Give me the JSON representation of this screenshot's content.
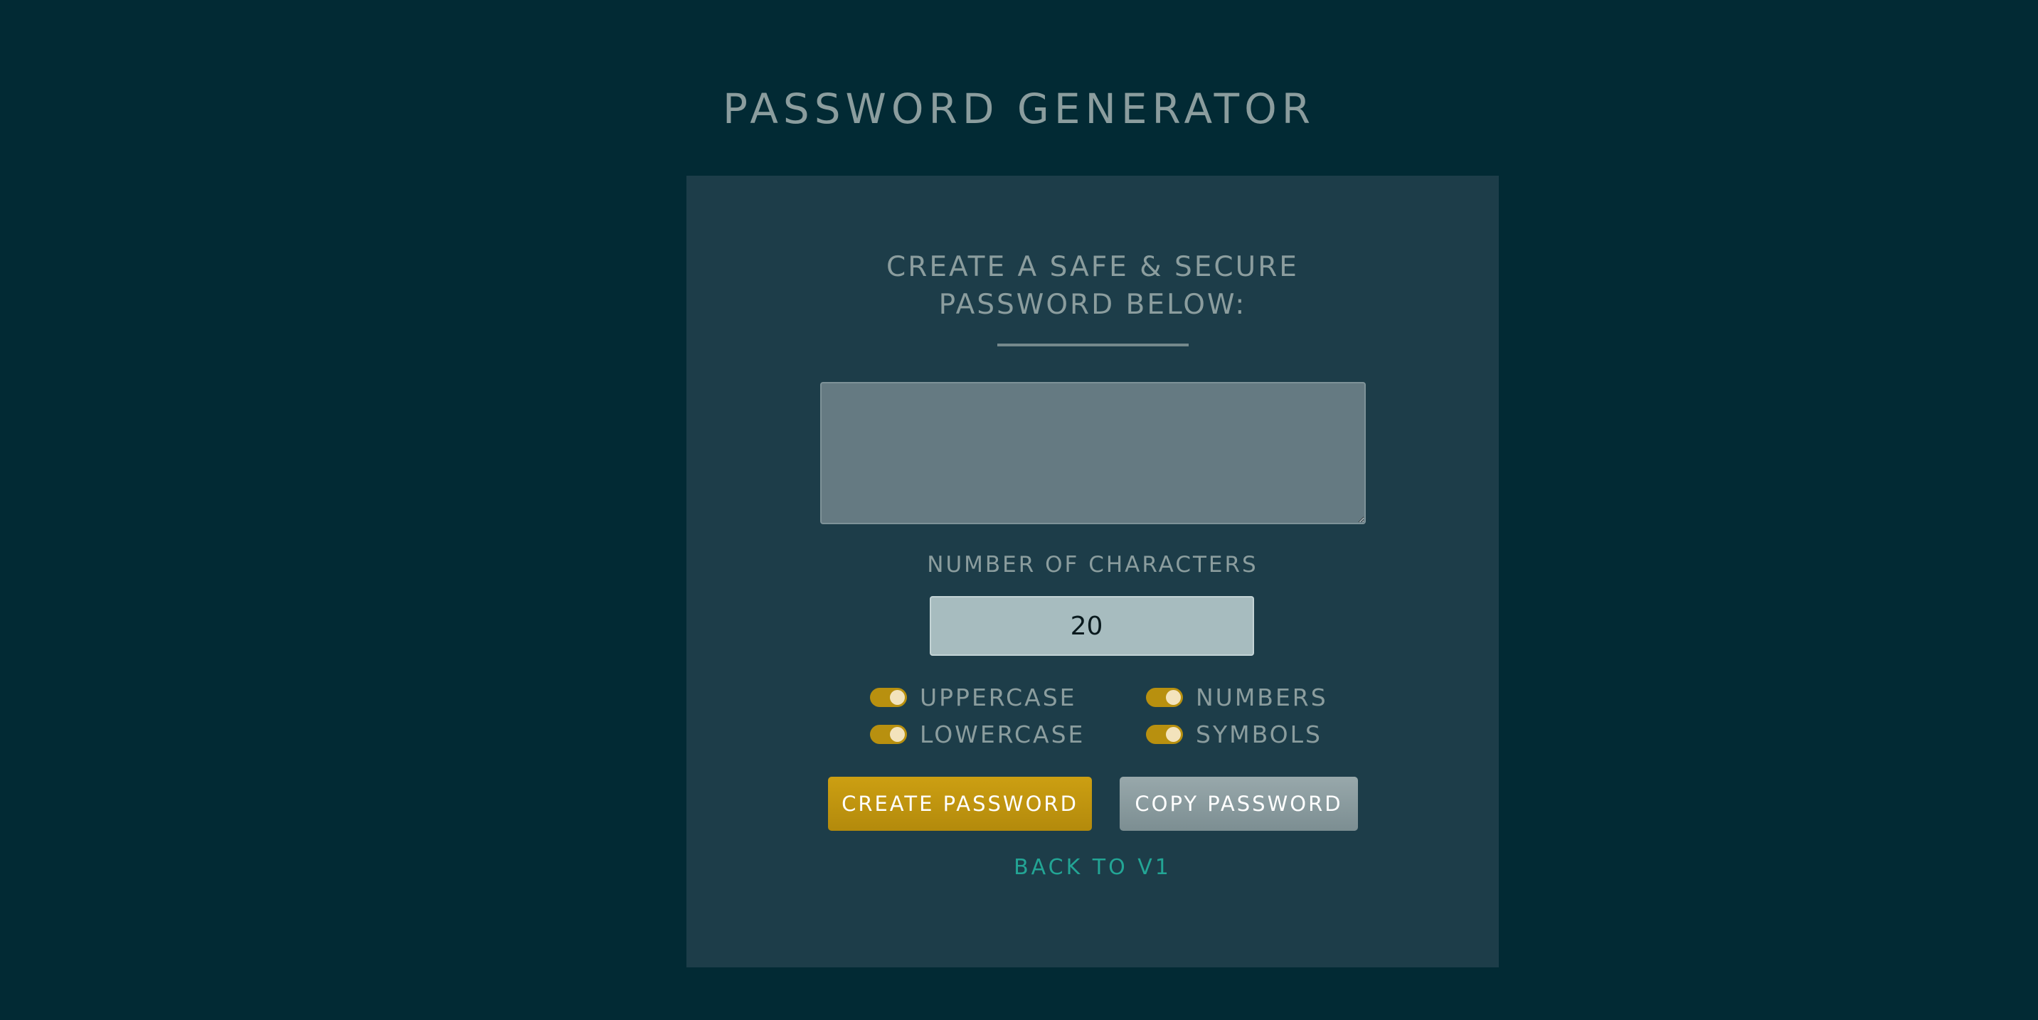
{
  "page": {
    "title": "PASSWORD GENERATOR"
  },
  "card": {
    "heading_line1": "CREATE A SAFE & SECURE",
    "heading_line2": "PASSWORD BELOW:",
    "password_output": "",
    "length_label": "NUMBER OF CHARACTERS",
    "length_value": "20",
    "options": {
      "uppercase": {
        "label": "UPPERCASE",
        "enabled": true
      },
      "lowercase": {
        "label": "LOWERCASE",
        "enabled": true
      },
      "numbers": {
        "label": "NUMBERS",
        "enabled": true
      },
      "symbols": {
        "label": "SYMBOLS",
        "enabled": true
      }
    },
    "create_button": "CREATE PASSWORD",
    "copy_button": "COPY PASSWORD",
    "back_link": "BACK TO V1"
  },
  "colors": {
    "background": "#022a34",
    "card": "#1d3d49",
    "accent": "#b8900f",
    "link": "#23a595"
  }
}
